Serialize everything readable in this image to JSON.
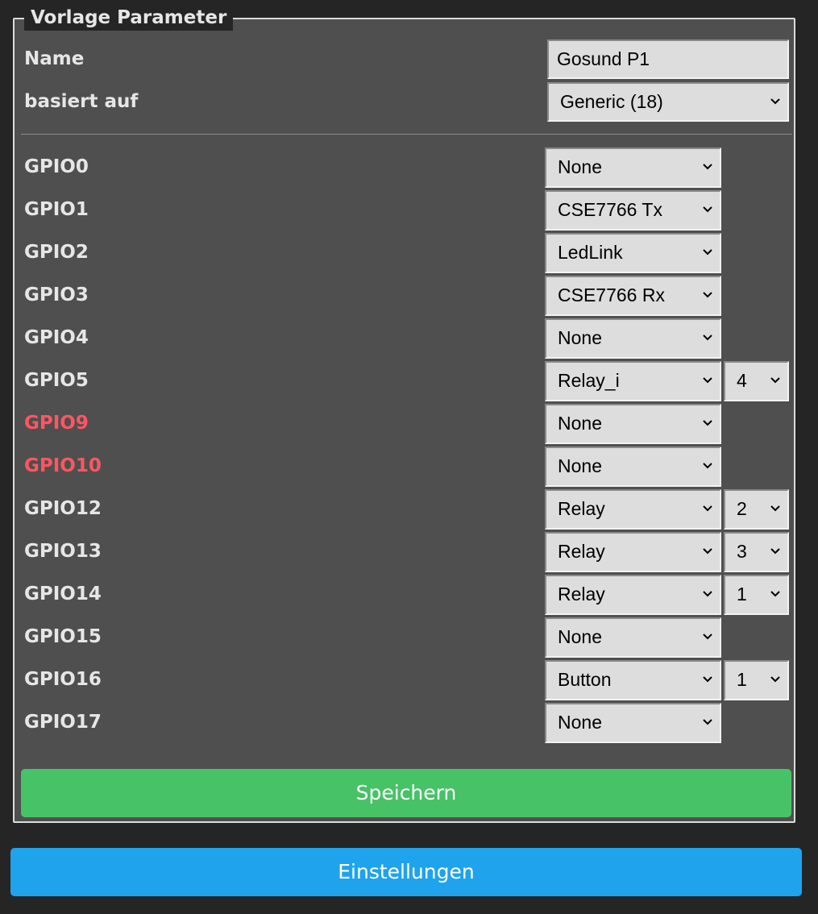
{
  "legend": "Vorlage Parameter",
  "name": {
    "label": "Name",
    "value": "Gosund P1"
  },
  "base": {
    "label": "basiert auf",
    "selected": "Generic (18)"
  },
  "gpios": [
    {
      "label": "GPIO0",
      "func": "None"
    },
    {
      "label": "GPIO1",
      "func": "CSE7766 Tx"
    },
    {
      "label": "GPIO2",
      "func": "LedLink"
    },
    {
      "label": "GPIO3",
      "func": "CSE7766 Rx"
    },
    {
      "label": "GPIO4",
      "func": "None"
    },
    {
      "label": "GPIO5",
      "func": "Relay_i",
      "index": "4"
    },
    {
      "label": "GPIO9",
      "func": "None",
      "warning": true
    },
    {
      "label": "GPIO10",
      "func": "None",
      "warning": true
    },
    {
      "label": "GPIO12",
      "func": "Relay",
      "index": "2"
    },
    {
      "label": "GPIO13",
      "func": "Relay",
      "index": "3"
    },
    {
      "label": "GPIO14",
      "func": "Relay",
      "index": "1"
    },
    {
      "label": "GPIO15",
      "func": "None"
    },
    {
      "label": "GPIO16",
      "func": "Button",
      "index": "1"
    },
    {
      "label": "GPIO17",
      "func": "None"
    }
  ],
  "buttons": {
    "save": "Speichern",
    "settings": "Einstellungen"
  },
  "colors": {
    "background": "#252525",
    "panel": "#4f4f4f",
    "text": "#e6e6e6",
    "warning": "#ff5661",
    "save": "#47c266",
    "settings": "#1fa3ec"
  }
}
